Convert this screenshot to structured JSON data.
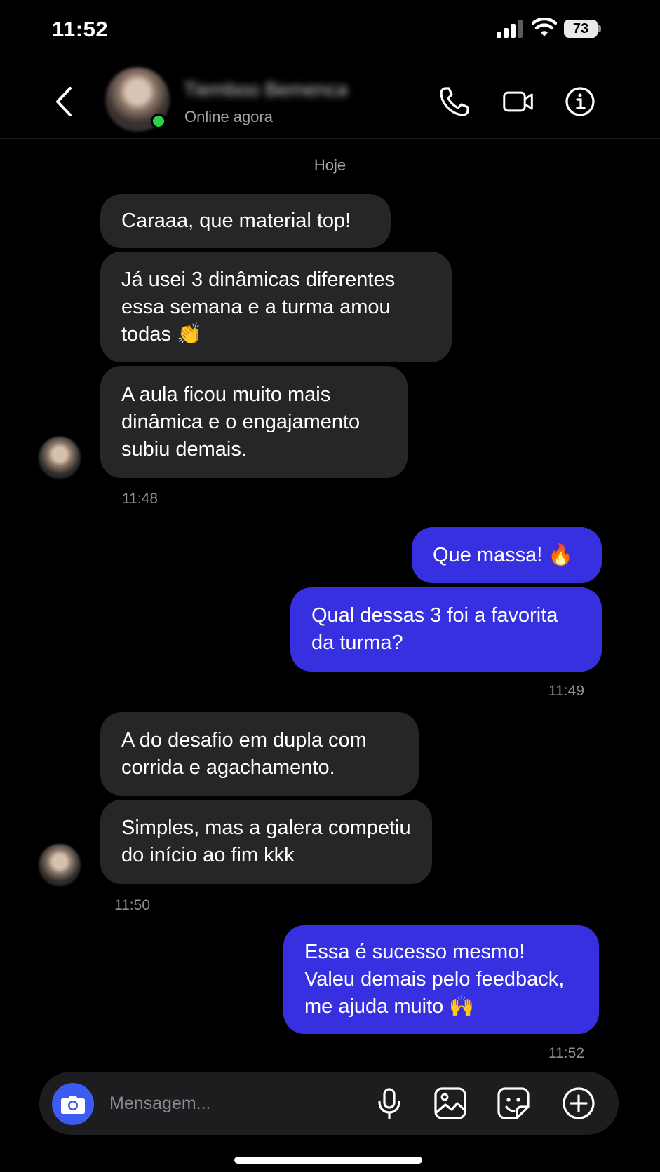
{
  "status_bar": {
    "time": "11:52",
    "battery": "73",
    "icons": [
      "signal-icon",
      "wifi-icon",
      "battery-icon"
    ]
  },
  "header": {
    "contact_name": "Tiemboo Bemenca",
    "contact_status": "Online agora",
    "icons": [
      "back-icon",
      "phone-icon",
      "video-icon",
      "info-icon"
    ],
    "online_color": "#2fcf49"
  },
  "thread": {
    "date_separator": "Hoje",
    "groups": [
      {
        "direction": "incoming",
        "messages": [
          {
            "text": "Caraaa, que material top!"
          },
          {
            "text": "Já usei 3 dinâmicas diferentes essa semana e a turma amou todas 👏"
          },
          {
            "text": "A aula ficou muito mais dinâmica e o engajamento subiu demais."
          }
        ],
        "time": "11:48"
      },
      {
        "direction": "outgoing",
        "messages": [
          {
            "text": "Que massa! 🔥"
          },
          {
            "text": "Qual dessas 3 foi a favorita da turma?"
          }
        ],
        "time": "11:49"
      },
      {
        "direction": "incoming",
        "messages": [
          {
            "text": "A do desafio em dupla com corrida e agachamento."
          },
          {
            "text": "Simples, mas a galera competiu do início ao fim kkk"
          }
        ],
        "time": "11:50"
      },
      {
        "direction": "outgoing",
        "messages": [
          {
            "text": "Essa é sucesso mesmo! Valeu demais pelo feedback, me ajuda muito 🙌"
          }
        ],
        "time": "11:52"
      }
    ]
  },
  "composer": {
    "placeholder": "Mensagem...",
    "value": "",
    "icons": [
      "camera-icon",
      "microphone-icon",
      "gallery-icon",
      "sticker-icon",
      "plus-icon"
    ]
  },
  "colors": {
    "background": "#000000",
    "incoming_bubble": "#262626",
    "outgoing_bubble": "#3730e0",
    "camera_button": "#3b5bf2",
    "composer_bg": "#1d1d1f"
  }
}
